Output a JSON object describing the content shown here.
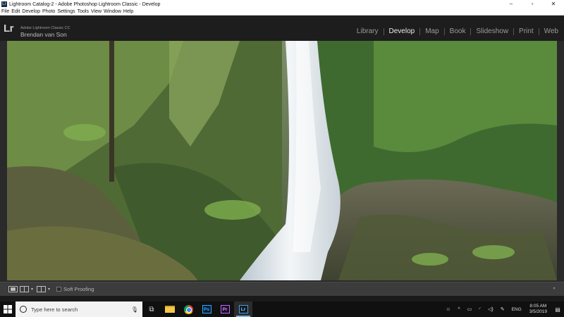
{
  "window": {
    "title": "Lightroom Catalog-2 - Adobe Photoshop Lightroom Classic - Develop",
    "app_icon_text": "Lr",
    "controls": {
      "minimize": "–",
      "maximize": "▫",
      "close": "✕"
    }
  },
  "menubar": {
    "items": [
      "File",
      "Edit",
      "Develop",
      "Photo",
      "Settings",
      "Tools",
      "View",
      "Window",
      "Help"
    ]
  },
  "identity_plate": {
    "logo": "Lr",
    "product": "Adobe Lightroom Classic CC",
    "user": "Brendan van Son"
  },
  "modules": [
    {
      "label": "Library",
      "active": false
    },
    {
      "label": "Develop",
      "active": true
    },
    {
      "label": "Map",
      "active": false
    },
    {
      "label": "Book",
      "active": false
    },
    {
      "label": "Slideshow",
      "active": false
    },
    {
      "label": "Print",
      "active": false
    },
    {
      "label": "Web",
      "active": false
    }
  ],
  "toolbar": {
    "soft_proofing_label": "Soft Proofing",
    "soft_proofing_checked": false
  },
  "taskbar": {
    "search_placeholder": "Type here to search",
    "apps": [
      {
        "name": "task-view",
        "icon": "task-view-icon"
      },
      {
        "name": "file-explorer",
        "icon": "folder-icon"
      },
      {
        "name": "chrome",
        "icon": "chrome-icon"
      },
      {
        "name": "photoshop",
        "icon": "photoshop-icon",
        "text": "Ps"
      },
      {
        "name": "premiere",
        "icon": "premiere-icon",
        "text": "Pr"
      },
      {
        "name": "lightroom",
        "icon": "lightroom-icon",
        "text": "Lr",
        "active": true
      }
    ],
    "tray": {
      "language": "ENG",
      "time": "8:05 AM",
      "date": "3/5/2019"
    }
  },
  "colors": {
    "module_active": "#ececec",
    "module_inactive": "#9b9b9b",
    "taskbar_accent": "#7ab4e8"
  }
}
